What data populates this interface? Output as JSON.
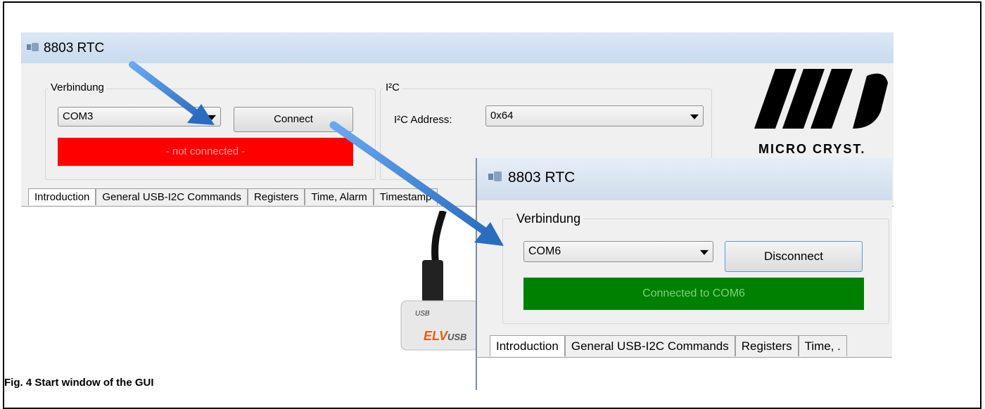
{
  "window_back": {
    "title": "8803 RTC",
    "connection_group": {
      "legend": "Verbindung",
      "port_value": "COM3",
      "connect_label": "Connect",
      "status_text": "- not connected -",
      "status_color": "#ff0000"
    },
    "i2c_group": {
      "legend": "I²C",
      "address_label": "I²C Address:",
      "address_value": "0x64"
    },
    "tabs": [
      "Introduction",
      "General USB-I2C Commands",
      "Registers",
      "Time, Alarm",
      "Timestamp"
    ]
  },
  "logo": {
    "text": "MICRO CRYST."
  },
  "device": {
    "usb_label": "USB",
    "brand": "ELV",
    "brand_suffix": "USB"
  },
  "window_front": {
    "title": "8803 RTC",
    "connection_group": {
      "legend": "Verbindung",
      "port_value": "COM6",
      "disconnect_label": "Disconnect",
      "status_text": "Connected to COM6",
      "status_color": "#008000"
    },
    "tabs": [
      "Introduction",
      "General USB-I2C Commands",
      "Registers",
      "Time, ."
    ]
  },
  "caption": "Fig. 4   Start window of the GUI",
  "colors": {
    "arrow": "#3f7fd0",
    "titlebar": "#cfdcec"
  }
}
